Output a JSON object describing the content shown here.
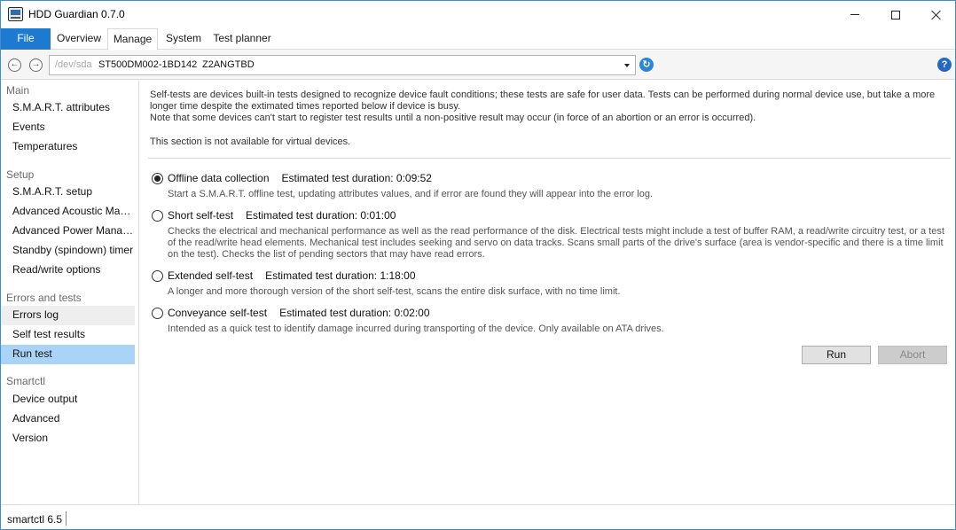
{
  "window": {
    "title": "HDD Guardian 0.7.0"
  },
  "tabs": [
    {
      "label": "File"
    },
    {
      "label": "Overview"
    },
    {
      "label": "Manage"
    },
    {
      "label": "System"
    },
    {
      "label": "Test planner"
    }
  ],
  "device": {
    "path": "/dev/sda",
    "model": "ST500DM002-1BD142",
    "serial": "Z2ANGTBD"
  },
  "sidebar": {
    "groups": [
      {
        "label": "Main",
        "items": [
          "S.M.A.R.T. attributes",
          "Events",
          "Temperatures"
        ]
      },
      {
        "label": "Setup",
        "items": [
          "S.M.A.R.T. setup",
          "Advanced Acoustic Management",
          "Advanced Power Management",
          "Standby (spindown) timer",
          "Read/write options"
        ]
      },
      {
        "label": "Errors and tests",
        "items": [
          "Errors log",
          "Self test results",
          "Run test"
        ]
      },
      {
        "label": "Smartctl",
        "items": [
          "Device output",
          "Advanced",
          "Version"
        ]
      }
    ],
    "selected": "Run test"
  },
  "content": {
    "intro": "Self-tests are devices built-in tests designed to recognize device fault conditions; these tests are safe for user data. Tests can be performed during normal device use, but take a more longer time despite the extimated times reported below if device is busy.",
    "intro_note": "Note that some devices can't start to register test results until a non-positive result may occur (in force of an abortion or an error is occurred).",
    "virtual_note": "This section is not available for virtual devices.",
    "tests": [
      {
        "label": "Offline data collection",
        "duration": "Estimated test duration: 0:09:52",
        "description": "Start a S.M.A.R.T. offline test, updating attributes values, and if error are found they will appear into the error log.",
        "checked": true
      },
      {
        "label": "Short self-test",
        "duration": "Estimated test duration: 0:01:00",
        "description": "Checks the electrical and mechanical performance as well as the read performance of the disk. Electrical tests might include a test of buffer RAM, a read/write circuitry test, or a test of the read/write head elements. Mechanical test includes seeking and servo on data tracks. Scans small parts of the drive's surface (area is vendor-specific and there is a time limit on the test). Checks the list of pending sectors that may have read errors.",
        "checked": false
      },
      {
        "label": "Extended self-test",
        "duration": "Estimated test duration: 1:18:00",
        "description": "A longer and more thorough version of the short self-test, scans the entire disk surface, with no time limit.",
        "checked": false
      },
      {
        "label": "Conveyance self-test",
        "duration": "Estimated test duration: 0:02:00",
        "description": "Intended as a quick test to identify damage incurred during transporting of the device. Only available on ATA drives.",
        "checked": false
      }
    ],
    "run_label": "Run",
    "abort_label": "Abort"
  },
  "status": {
    "text": "smartctl 6.5"
  },
  "colors": {
    "accent": "#1e7ad0",
    "selected": "#aad4f7"
  }
}
